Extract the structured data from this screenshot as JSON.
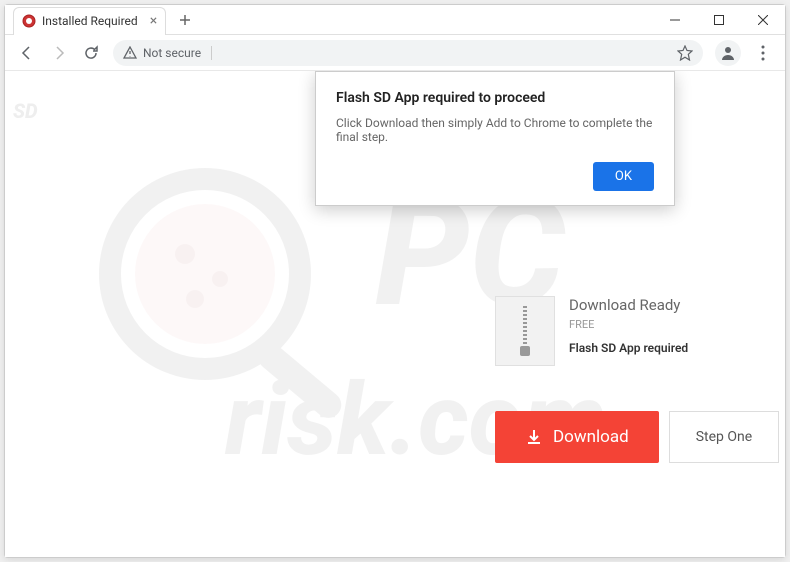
{
  "window": {
    "tab_title": "Installed Required",
    "security_label": "Not secure",
    "url": ""
  },
  "dialog": {
    "title": "Flash SD App required to proceed",
    "body": "Click Download then simply Add to Chrome to complete the final step.",
    "ok_label": "OK"
  },
  "download_ready": {
    "heading": "Download Ready",
    "free_label": "FREE",
    "requirement": "Flash SD App required"
  },
  "actions": {
    "download_label": "Download",
    "step_label": "Step One"
  },
  "watermark": {
    "text_top": "PC",
    "text_bottom": "risk.com",
    "corner": "SD"
  },
  "icons": {
    "back": "back-icon",
    "forward": "forward-icon",
    "reload": "reload-icon",
    "warning": "warning-icon",
    "star": "star-icon",
    "profile": "profile-icon",
    "menu": "menu-icon",
    "minimize": "minimize-icon",
    "maximize": "maximize-icon",
    "close": "close-icon",
    "new_tab": "plus-icon",
    "tab_close": "x-icon",
    "download_arrow": "download-arrow-icon",
    "zipper": "zipper-icon"
  },
  "colors": {
    "accent": "#1a73e8",
    "danger": "#f44336"
  }
}
